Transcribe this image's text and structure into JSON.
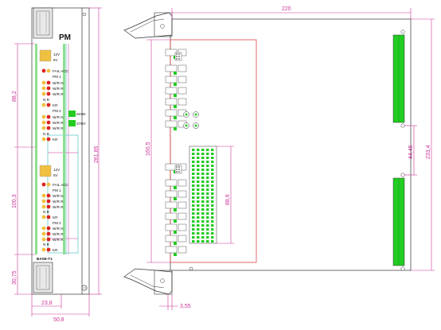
{
  "front_panel": {
    "title": "PM",
    "module_labels": {
      "sw12": "12V",
      "sw5": "5V",
      "fail_acc": "FAIL ACC",
      "pm1": "PM 1",
      "wrn1": "W/R N",
      "wrr1": "W/R R",
      "wrr2": "W/R R",
      "nr": "N R",
      "kr": "KR",
      "pm2": "PM 2",
      "wrn2": "W/R N",
      "wrr3": "W/R R",
      "wrr4": "W/R R",
      "nr2": "N R",
      "kr2": "KR",
      "btn1": "MAIN",
      "btn2": "STBY",
      "sw12b": "12V",
      "sw5b": "5V",
      "fail_acc_b": "FAIL ACC",
      "pm1b": "PM 1",
      "wrn1b": "W/R N",
      "wrr1b": "W/R R",
      "wrr2b": "W/R R",
      "nrb": "N R",
      "krb": "KR",
      "pm2b": "PM 2",
      "wrn2b": "W/R N",
      "wrr3b": "W/R R",
      "wrr4b": "W/R R",
      "nr2b": "N R",
      "kr2b": "KR",
      "brand": "BASE-T1"
    }
  },
  "dimensions": {
    "width_total": "220",
    "panel_height": "261,85",
    "section1": "88,2",
    "section2": "100,3",
    "bottom": "30,75",
    "w1": "23,8",
    "w2": "50,8",
    "pcb_height": "160,5",
    "connector_span": "88,9",
    "gap": "44,45",
    "board_height": "233,4",
    "pitch": "3,55"
  },
  "colors": {
    "dimension": "#cc3399",
    "outline": "#333333",
    "connector_green": "#22cc22",
    "led_red": "#dd2222",
    "led_yellow": "#f0c040",
    "cyan": "#66cccc",
    "pcb_red": "#dd4444"
  }
}
